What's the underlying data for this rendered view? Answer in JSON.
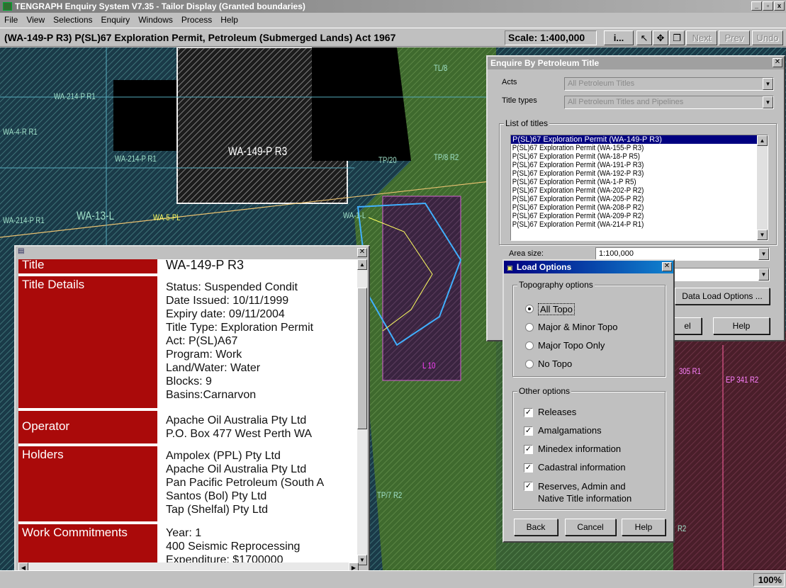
{
  "window": {
    "title": "TENGRAPH Enquiry System V7.35 - Tailor Display (Granted boundaries)",
    "controls": [
      "_",
      "▫",
      "x"
    ]
  },
  "menu": [
    "File",
    "View",
    "Selections",
    "Enquiry",
    "Windows",
    "Process",
    "Help"
  ],
  "infobar": {
    "title": "(WA-149-P R3) P(SL)67 Exploration Permit, Petroleum (Submerged Lands) Act 1967",
    "scale": "Scale: 1:400,000",
    "info_button": "i...",
    "next": "Next",
    "prev": "Prev",
    "undo": "Undo"
  },
  "map": {
    "labels": [
      {
        "text": "WA-214-P R1"
      },
      {
        "text": "WA-4-R R1"
      },
      {
        "text": "WA-214-P R1"
      },
      {
        "text": "WA-149-P R3"
      },
      {
        "text": "WA-214-P R1"
      },
      {
        "text": "WA-13-L"
      },
      {
        "text": "WA-5-PL"
      },
      {
        "text": "TL/8"
      },
      {
        "text": "TP/20"
      },
      {
        "text": "TP/8 R2"
      },
      {
        "text": "WA-1-L"
      },
      {
        "text": "L 10"
      },
      {
        "text": "TP/7 R2"
      },
      {
        "text": "305 R1"
      },
      {
        "text": "EP 341 R2"
      },
      {
        "text": "R2"
      }
    ]
  },
  "enquire_dialog": {
    "title": "Enquire By Petroleum Title",
    "acts_label": "Acts",
    "acts_value": "All Petroleum Titles",
    "title_types_label": "Title types",
    "title_types_value": "All Petroleum Titles and Pipelines",
    "list_label": "List of titles",
    "titles": [
      "P(SL)67 Exploration Permit (WA-149-P R3)",
      "P(SL)67 Exploration Permit (WA-155-P R3)",
      "P(SL)67 Exploration Permit (WA-18-P R5)",
      "P(SL)67 Exploration Permit (WA-191-P R3)",
      "P(SL)67 Exploration Permit (WA-192-P R3)",
      "P(SL)67 Exploration Permit (WA-1-P R5)",
      "P(SL)67 Exploration Permit (WA-202-P R2)",
      "P(SL)67 Exploration Permit (WA-205-P R2)",
      "P(SL)67 Exploration Permit (WA-208-P R2)",
      "P(SL)67 Exploration Permit (WA-209-P R2)",
      "P(SL)67 Exploration Permit (WA-214-P R1)"
    ],
    "area_size_label": "Area size:",
    "area_size_value": "1:100,000",
    "data_load_button": "Data Load Options ...",
    "cancel_button_fragment": "el",
    "help_button": "Help"
  },
  "load_options": {
    "title": "Load Options",
    "topo_group": "Topography options",
    "topo_options": [
      "All Topo",
      "Major & Minor Topo",
      "Major Topo Only",
      "No Topo"
    ],
    "topo_selected": 0,
    "other_group": "Other options",
    "other_options": [
      "Releases",
      "Amalgamations",
      "Minedex information",
      "Cadastral information",
      "Reserves, Admin and",
      "Native Title information"
    ],
    "back": "Back",
    "cancel": "Cancel",
    "help": "Help"
  },
  "title_popup": {
    "rows": [
      {
        "head": "Title",
        "lines": [
          "WA-149-P R3"
        ]
      },
      {
        "head": "Title Details",
        "lines": [
          "Status: Suspended Condit",
          "Date Issued: 10/11/1999",
          "Expiry date: 09/11/2004",
          "Title Type: Exploration Permit",
          "Act: P(SL)A67",
          "Program: Work",
          "Land/Water: Water",
          "Blocks: 9",
          "Basins:Carnarvon"
        ]
      },
      {
        "head": "Operator",
        "lines": [
          "Apache Oil Australia Pty Ltd",
          "P.O. Box 477 West Perth WA"
        ]
      },
      {
        "head": "Holders",
        "lines": [
          "Ampolex (PPL) Pty Ltd",
          "Apache Oil Australia Pty Ltd",
          "Pan Pacific Petroleum (South A",
          "Santos (Bol) Pty Ltd",
          "Tap (Shelfal) Pty Ltd"
        ]
      },
      {
        "head": "Work Commitments",
        "lines": [
          "Year: 1",
          "400 Seismic Reprocessing",
          "Expenditure: $1700000"
        ]
      }
    ]
  },
  "status": {
    "zoom": "100%"
  }
}
